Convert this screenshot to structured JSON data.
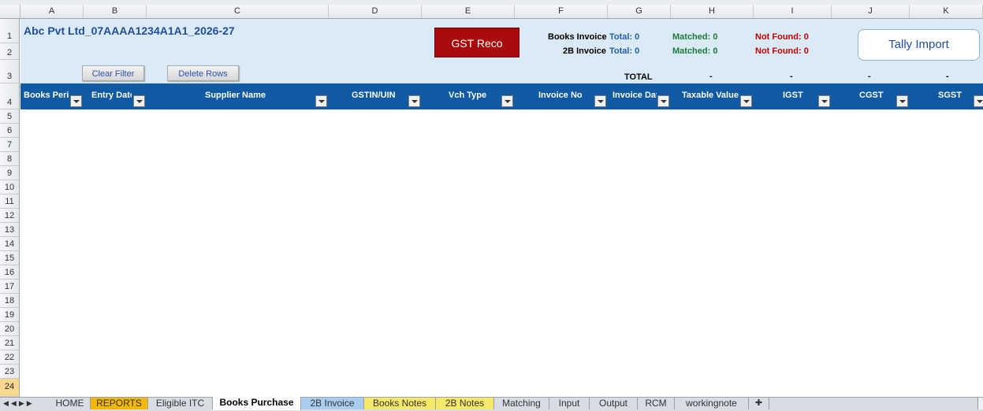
{
  "columns": [
    "A",
    "B",
    "C",
    "D",
    "E",
    "F",
    "G",
    "H",
    "I",
    "J",
    "K"
  ],
  "rows": [
    "1",
    "2",
    "3",
    "4",
    "5",
    "6",
    "7",
    "8",
    "9",
    "10",
    "11",
    "12",
    "13",
    "14",
    "15",
    "16",
    "17",
    "18",
    "19",
    "20",
    "21",
    "22",
    "23",
    "24"
  ],
  "selected_row": "24",
  "title": "Abc Pvt Ltd_07AAAA1234A1A1_2026-27",
  "buttons": {
    "gst_reco": "GST Reco",
    "tally_import": "Tally Import",
    "clear_filter": "Clear Filter",
    "delete_rows": "Delete Rows"
  },
  "summary": {
    "books_label": "Books Invoice",
    "books_total": "Total: 0",
    "books_matched": "Matched: 0",
    "books_not_found": "Not Found: 0",
    "twob_label": "2B Invoice",
    "twob_total": "Total: 0",
    "twob_matched": "Matched: 0",
    "twob_not_found": "Not Found: 0"
  },
  "totals": {
    "label": "TOTAL",
    "taxable": "-",
    "igst": "-",
    "cgst": "-",
    "sgst": "-"
  },
  "headers": [
    "Books Period",
    "Entry Date",
    "Supplier Name",
    "GSTIN/UIN",
    "Vch Type",
    "Invoice No",
    "Invoice Date",
    "Taxable Value",
    "IGST",
    "CGST",
    "SGST"
  ],
  "sheet_tabs": [
    "HOME",
    "REPORTS",
    "Eligible ITC",
    "Books Purchase",
    "2B Invoice",
    "Books Notes",
    "2B Notes",
    "Matching",
    "Input",
    "Output",
    "RCM",
    "workingnote"
  ],
  "active_tab": "Books Purchase",
  "colors": {
    "title": "#1f4e9c",
    "header_bg": "#0f5aa2",
    "gst_btn": "#a70b0b",
    "matched": "#1a7a3a",
    "not_found": "#c00000",
    "total_blue": "#1f5fa8",
    "reports_tab": "#f5b800",
    "twob_invoice_tab": "#a8cdf0",
    "notes_tab": "#f5e76a"
  }
}
